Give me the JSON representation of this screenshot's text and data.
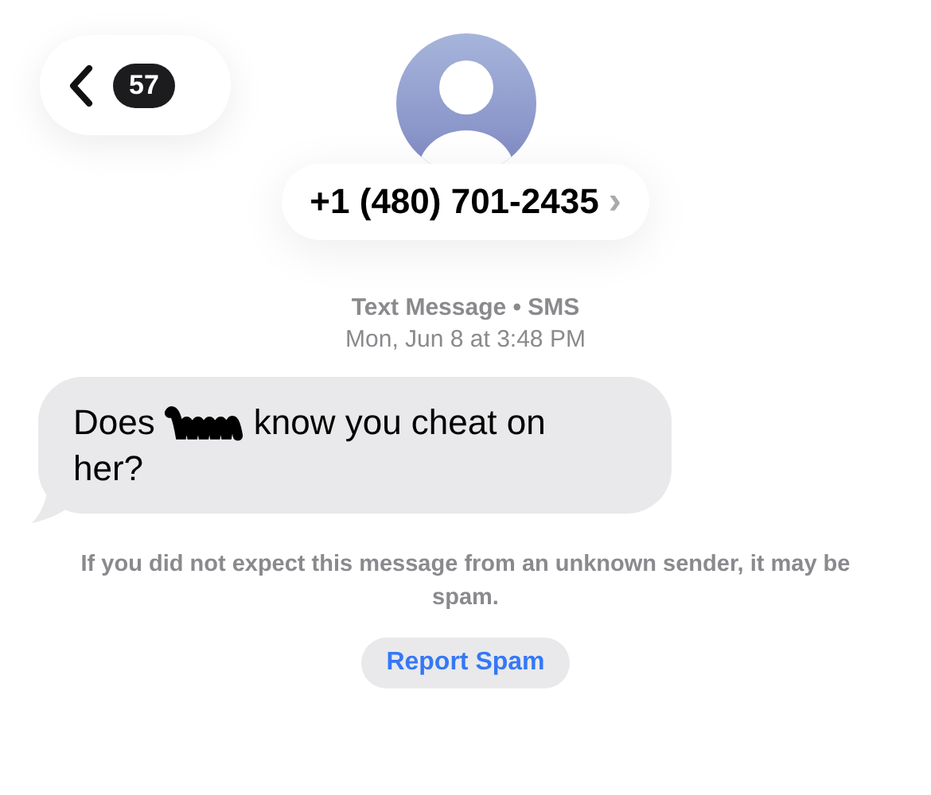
{
  "back": {
    "badge": "57"
  },
  "contact": {
    "phone": "+1 (480) 701-2435",
    "chevron": "›"
  },
  "meta": {
    "service": "Text Message • SMS",
    "timestamp": "Mon, Jun 8 at 3:48 PM"
  },
  "message": {
    "lines": [
      [
        {
          "kind": "text",
          "text": "Does"
        },
        {
          "kind": "redaction"
        },
        {
          "kind": "text",
          "text": "know you cheat on"
        }
      ],
      [
        {
          "kind": "text",
          "text": "her?"
        }
      ]
    ]
  },
  "spam_notice": "If you did not expect this message from an unknown sender, it may be spam.",
  "report_button": "Report Spam"
}
